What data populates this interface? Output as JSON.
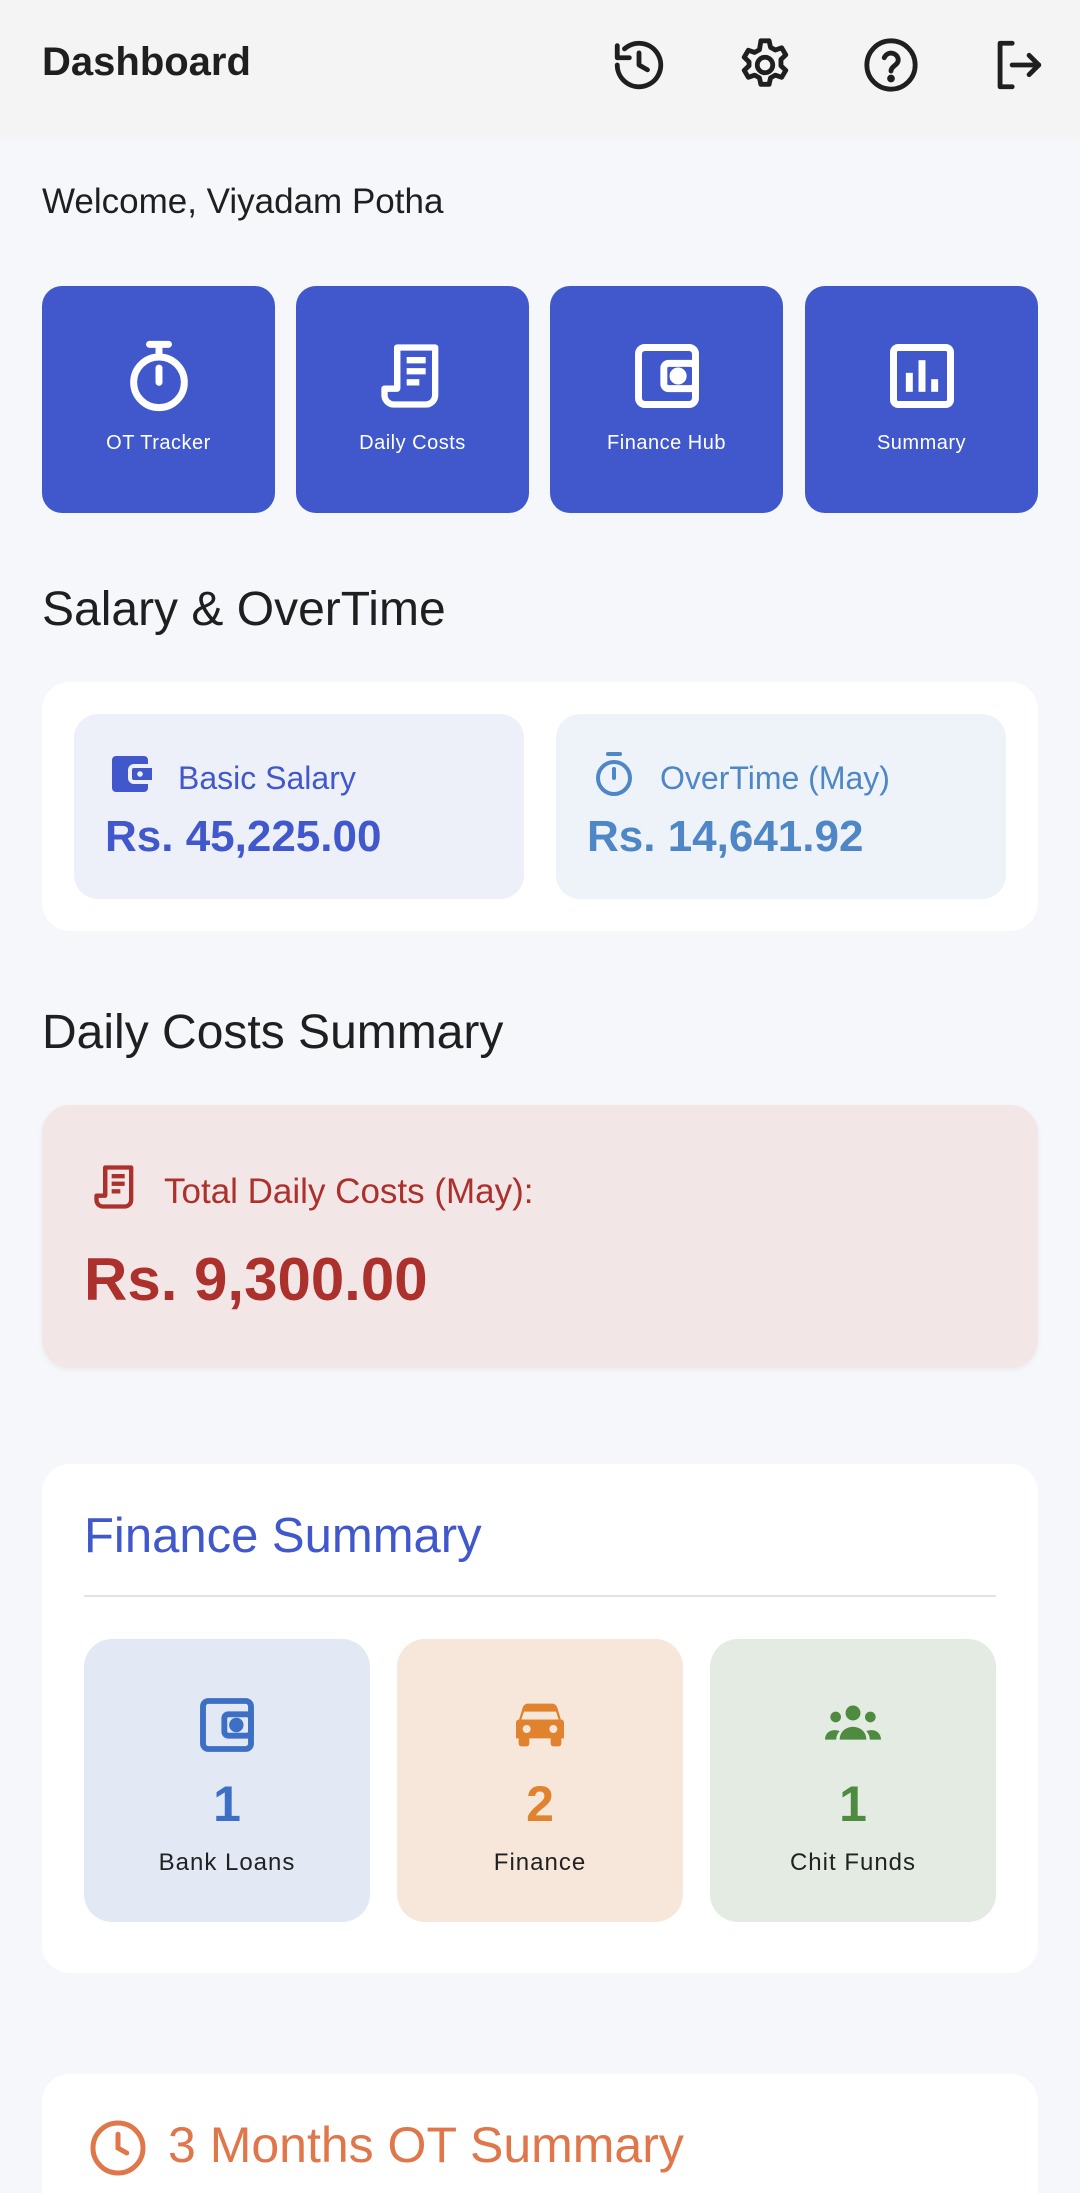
{
  "appbar": {
    "title": "Dashboard",
    "icons": [
      "history-icon",
      "settings-icon",
      "help-icon",
      "logout-icon"
    ]
  },
  "welcome": "Welcome, Viyadam Potha",
  "tiles": [
    {
      "label": "OT Tracker",
      "icon": "timer-icon"
    },
    {
      "label": "Daily Costs",
      "icon": "receipt-icon"
    },
    {
      "label": "Finance Hub",
      "icon": "wallet-icon"
    },
    {
      "label": "Summary",
      "icon": "bar-chart-icon"
    }
  ],
  "salary_section": {
    "title": "Salary & OverTime",
    "basic": {
      "label": "Basic Salary",
      "value": "Rs. 45,225.00",
      "icon": "wallet-icon"
    },
    "overtime": {
      "label": "OverTime (May)",
      "value": "Rs. 14,641.92",
      "icon": "timer-icon"
    }
  },
  "daily_costs": {
    "title": "Daily Costs Summary",
    "label": "Total Daily Costs (May):",
    "value": "Rs. 9,300.00",
    "icon": "receipt-icon"
  },
  "finance_summary": {
    "title": "Finance Summary",
    "items": [
      {
        "count": "1",
        "label": "Bank Loans",
        "icon": "wallet-icon"
      },
      {
        "count": "2",
        "label": "Finance",
        "icon": "car-icon"
      },
      {
        "count": "1",
        "label": "Chit Funds",
        "icon": "group-icon"
      }
    ]
  },
  "ot_summary": {
    "title": "3 Months OT Summary",
    "icon": "clock-icon"
  },
  "colors": {
    "primary": "#4058cb",
    "overtime": "#4f86c6",
    "cost": "#ac302c",
    "finance_blue": "#3d6fc4",
    "finance_orange": "#e0822e",
    "finance_green": "#4e8a40",
    "ot_orange": "#e0774a"
  }
}
